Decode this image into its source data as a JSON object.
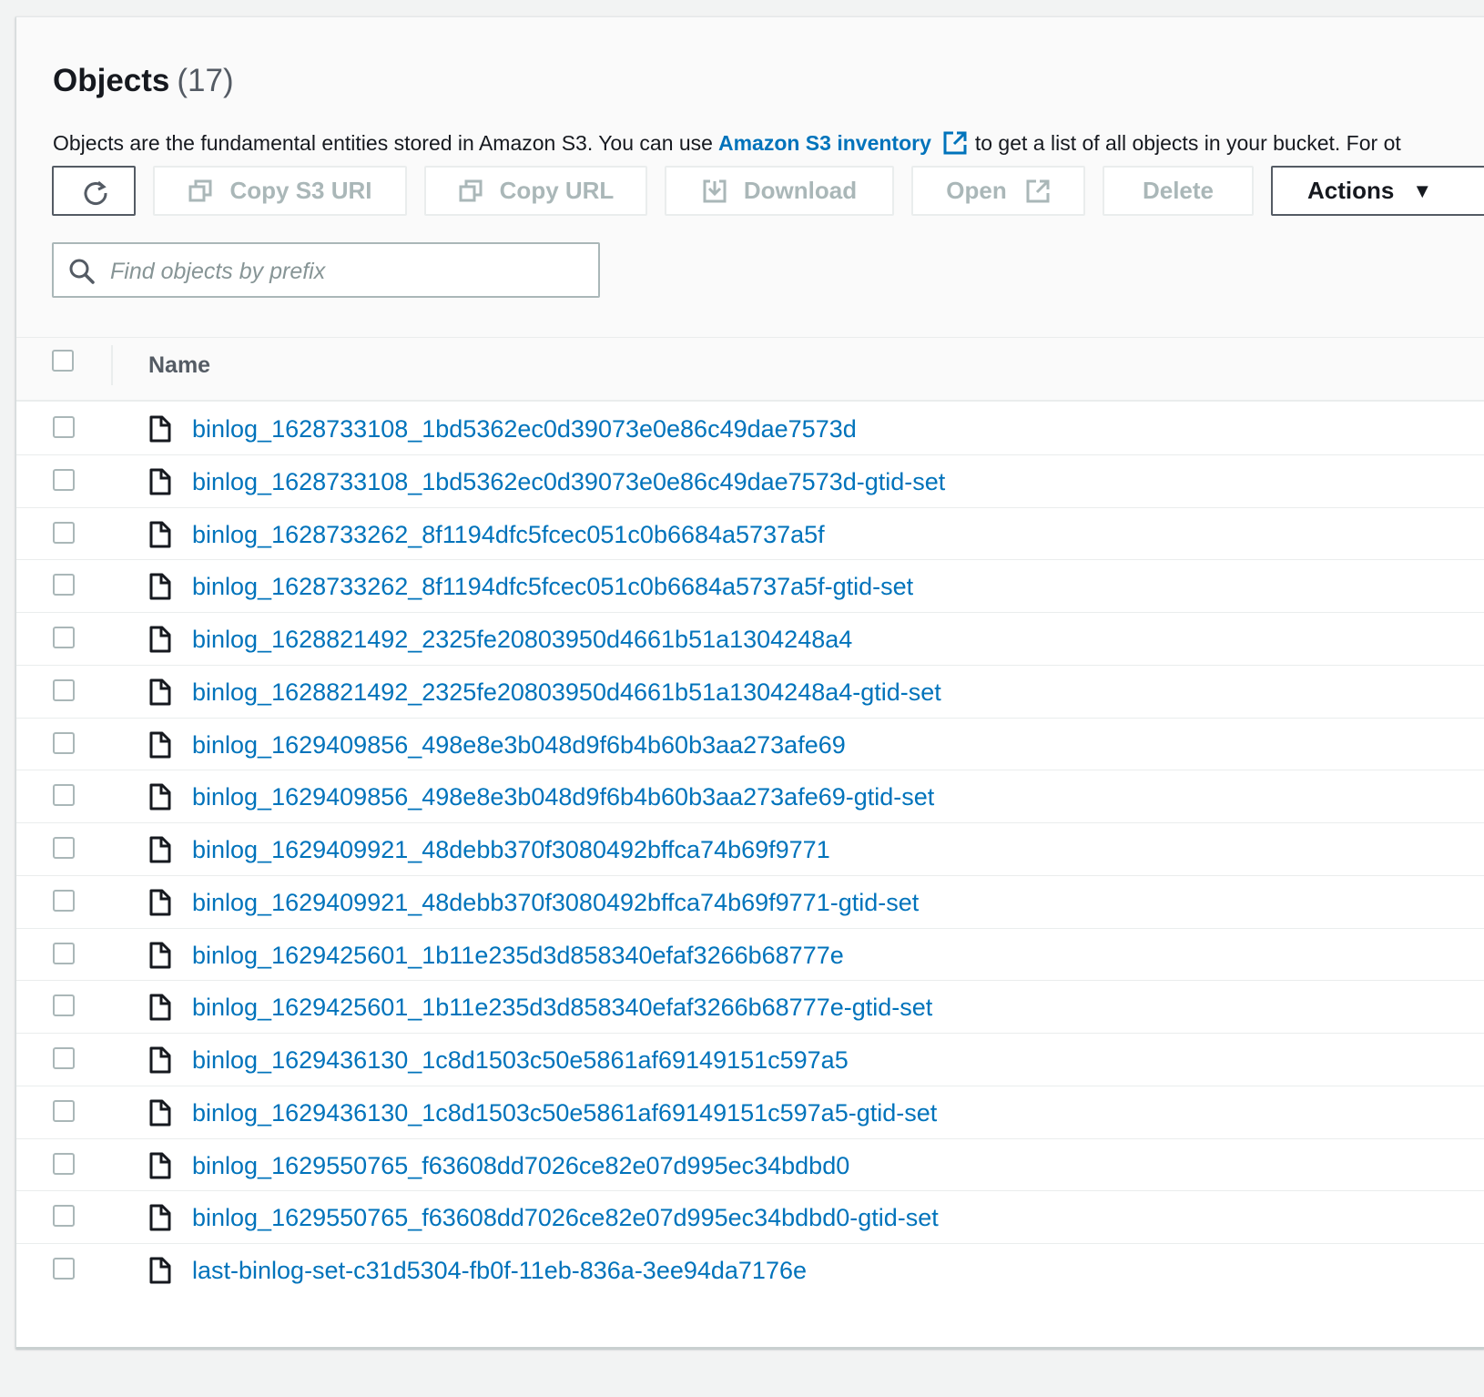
{
  "header": {
    "title": "Objects",
    "count": "(17)",
    "description_before": "Objects are the fundamental entities stored in Amazon S3. You can use",
    "description_link": "Amazon S3 inventory",
    "description_after": "to get a list of all objects in your bucket. For ot"
  },
  "toolbar": {
    "copy_s3_uri": "Copy S3 URI",
    "copy_url": "Copy URL",
    "download": "Download",
    "open": "Open",
    "delete": "Delete",
    "actions": "Actions",
    "actions_caret": "▼"
  },
  "search": {
    "placeholder": "Find objects by prefix"
  },
  "table": {
    "name_header": "Name",
    "rows": [
      {
        "name": "binlog_1628733108_1bd5362ec0d39073e0e86c49dae7573d"
      },
      {
        "name": "binlog_1628733108_1bd5362ec0d39073e0e86c49dae7573d-gtid-set"
      },
      {
        "name": "binlog_1628733262_8f1194dfc5fcec051c0b6684a5737a5f"
      },
      {
        "name": "binlog_1628733262_8f1194dfc5fcec051c0b6684a5737a5f-gtid-set"
      },
      {
        "name": "binlog_1628821492_2325fe20803950d4661b51a1304248a4"
      },
      {
        "name": "binlog_1628821492_2325fe20803950d4661b51a1304248a4-gtid-set"
      },
      {
        "name": "binlog_1629409856_498e8e3b048d9f6b4b60b3aa273afe69"
      },
      {
        "name": "binlog_1629409856_498e8e3b048d9f6b4b60b3aa273afe69-gtid-set"
      },
      {
        "name": "binlog_1629409921_48debb370f3080492bffca74b69f9771"
      },
      {
        "name": "binlog_1629409921_48debb370f3080492bffca74b69f9771-gtid-set"
      },
      {
        "name": "binlog_1629425601_1b11e235d3d858340efaf3266b68777e"
      },
      {
        "name": "binlog_1629425601_1b11e235d3d858340efaf3266b68777e-gtid-set"
      },
      {
        "name": "binlog_1629436130_1c8d1503c50e5861af69149151c597a5"
      },
      {
        "name": "binlog_1629436130_1c8d1503c50e5861af69149151c597a5-gtid-set"
      },
      {
        "name": "binlog_1629550765_f63608dd7026ce82e07d995ec34bdbd0"
      },
      {
        "name": "binlog_1629550765_f63608dd7026ce82e07d995ec34bdbd0-gtid-set"
      },
      {
        "name": "last-binlog-set-c31d5304-fb0f-11eb-836a-3ee94da7176e"
      }
    ]
  },
  "colors": {
    "link": "#0073bb",
    "disabled": "#aab7b8",
    "text": "#16191f"
  }
}
